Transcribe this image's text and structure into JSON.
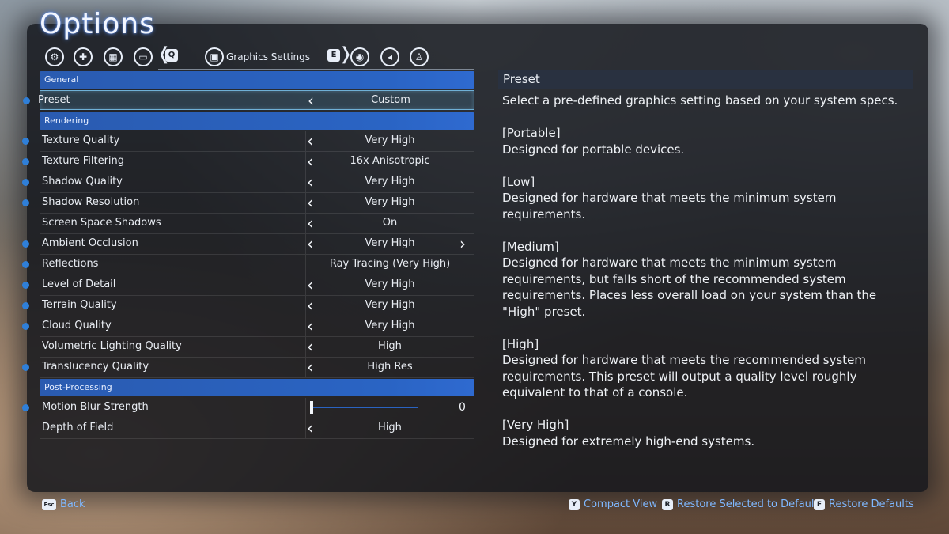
{
  "title": "Options",
  "tabs": {
    "active_label": "Graphics Settings",
    "prev_key": "Q",
    "next_key": "E",
    "icons": [
      "gear-icon",
      "gamepad-icon",
      "keyboard-icon",
      "display-icon",
      "graphics-icon",
      "interface-icon",
      "audio-icon",
      "accessibility-icon"
    ]
  },
  "sections": {
    "general": "General",
    "rendering": "Rendering",
    "post": "Post-Processing"
  },
  "settings": {
    "preset": {
      "label": "Preset",
      "value": "Custom"
    },
    "texture_quality": {
      "label": "Texture Quality",
      "value": "Very High"
    },
    "texture_filtering": {
      "label": "Texture Filtering",
      "value": "16x Anisotropic"
    },
    "shadow_quality": {
      "label": "Shadow Quality",
      "value": "Very High"
    },
    "shadow_resolution": {
      "label": "Shadow Resolution",
      "value": "Very High"
    },
    "screen_space_shadows": {
      "label": "Screen Space Shadows",
      "value": "On"
    },
    "ambient_occlusion": {
      "label": "Ambient Occlusion",
      "value": "Very High"
    },
    "reflections": {
      "label": "Reflections",
      "value": "Ray Tracing (Very High)"
    },
    "level_of_detail": {
      "label": "Level of Detail",
      "value": "Very High"
    },
    "terrain_quality": {
      "label": "Terrain Quality",
      "value": "Very High"
    },
    "cloud_quality": {
      "label": "Cloud Quality",
      "value": "Very High"
    },
    "volumetric_lighting": {
      "label": "Volumetric Lighting Quality",
      "value": "High"
    },
    "translucency_quality": {
      "label": "Translucency Quality",
      "value": "High Res"
    },
    "motion_blur": {
      "label": "Motion Blur Strength",
      "value": "0"
    },
    "depth_of_field": {
      "label": "Depth of Field",
      "value": "High"
    }
  },
  "description": {
    "title": "Preset",
    "intro": "Select a pre-defined graphics setting based on your system specs.",
    "portable_head": "[Portable]",
    "portable_text": "Designed for portable devices.",
    "low_head": "[Low]",
    "low_text": "Designed for hardware that meets the minimum system requirements.",
    "medium_head": "[Medium]",
    "medium_text": "Designed for hardware that meets the minimum system requirements, but falls short of the recommended system requirements. Places less overall load on your system than the \"High\" preset.",
    "high_head": "[High]",
    "high_text": "Designed for hardware that meets the recommended system requirements. This preset will output a quality level roughly equivalent to that of a console.",
    "veryhigh_head": "[Very High]",
    "veryhigh_text": "Designed for extremely high-end systems."
  },
  "footer": {
    "back_key": "Esc",
    "back_label": "Back",
    "compact_key": "Y",
    "compact_label": "Compact View",
    "restore_sel_key": "R",
    "restore_sel_label": "Restore Selected to Default",
    "restore_all_key": "F",
    "restore_all_label": "Restore Defaults"
  },
  "colors": {
    "accent": "#2a5bb0",
    "dot": "#2f7fd8",
    "footer_link": "#7fb8ff"
  }
}
